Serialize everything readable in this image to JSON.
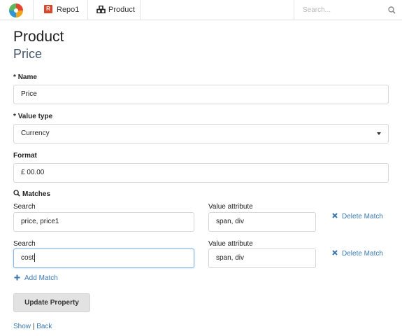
{
  "nav": {
    "logo_icon": "app-logo-icon",
    "repo_badge": "R",
    "repo_label": "Repo1",
    "product_label": "Product",
    "search_placeholder": "Search...",
    "search_value": ""
  },
  "page": {
    "title": "Product",
    "subtitle": "Price"
  },
  "form": {
    "name_label": "Name",
    "name_value": "Price",
    "value_type_label": "Value type",
    "value_type_value": "Currency",
    "format_label": "Format",
    "format_value": "£ 00.00",
    "required_marker": "*",
    "matches_label": "Matches",
    "matches": [
      {
        "search_label": "Search",
        "search_value": "price, price1",
        "attr_label": "Value attribute",
        "attr_value": "span, div",
        "delete_label": "Delete Match"
      },
      {
        "search_label": "Search",
        "search_value": "cost",
        "attr_label": "Value attribute",
        "attr_value": "span, div",
        "delete_label": "Delete Match"
      }
    ],
    "add_match_label": "Add Match",
    "submit_label": "Update Property"
  },
  "footer": {
    "show_label": "Show",
    "separator": "|",
    "back_label": "Back"
  },
  "colors": {
    "link": "#3a78b0",
    "repo_badge": "#d9472b",
    "subtitle": "#44556a",
    "focus_border": "#87b7e0"
  }
}
